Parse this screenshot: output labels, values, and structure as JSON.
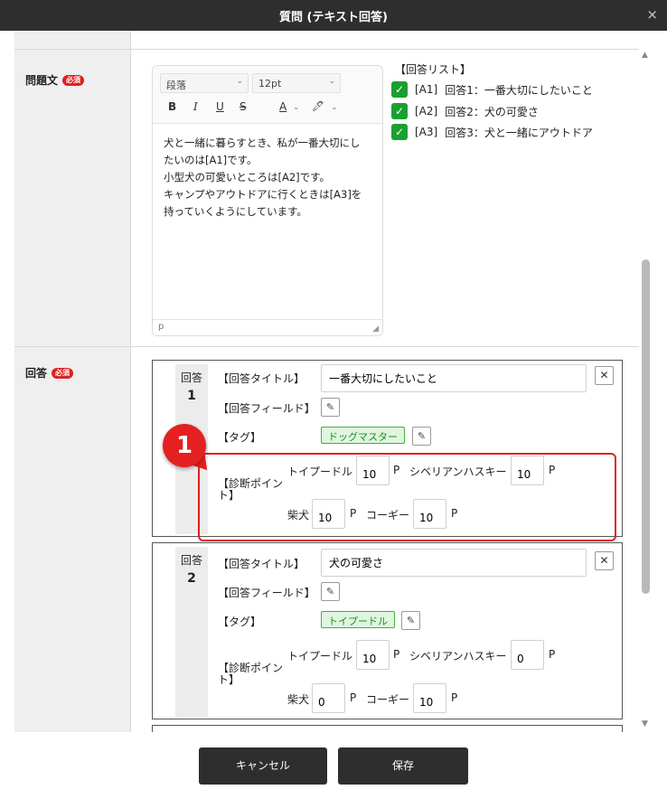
{
  "dialog": {
    "title": "質問 (テキスト回答)",
    "close_glyph": "×"
  },
  "fields": {
    "question_label": "問題文",
    "answers_label": "回答",
    "required_badge": "必須"
  },
  "editor": {
    "paragraph_select": "段落",
    "size_select": "12pt",
    "toolbar": {
      "bold": "B",
      "italic": "I",
      "underline": "U",
      "strike": "S",
      "font_color": "A",
      "highlight": "🖊"
    },
    "lines": [
      "犬と一緒に暮らすとき、私が一番大切にし",
      "たいのは[A1]です。",
      "小型犬の可愛いところは[A2]です。",
      "キャンプやアウトドアに行くときは[A3]を",
      "持っていくようにしています。"
    ],
    "status": "p"
  },
  "answer_list": {
    "title": "【回答リスト】",
    "items": [
      {
        "key": "[A1]",
        "text": "回答1：一番大切にしたいこと"
      },
      {
        "key": "[A2]",
        "text": "回答2：犬の可愛さ"
      },
      {
        "key": "[A3]",
        "text": "回答3：犬と一緒にアウトドア"
      }
    ]
  },
  "answers": [
    {
      "num_label": "回答",
      "num": "1",
      "title_label": "【回答タイトル】",
      "title_value": "一番大切にしたいこと",
      "field_label": "【回答フィールド】",
      "tag_label": "【タグ】",
      "tag": "ドッグマスター",
      "diag_label": "【診断ポイント】",
      "points": [
        {
          "name": "トイプードル",
          "value": "10",
          "unit": "P"
        },
        {
          "name": "シベリアンハスキー",
          "value": "10",
          "unit": "P"
        },
        {
          "name": "柴犬",
          "value": "10",
          "unit": "P"
        },
        {
          "name": "コーギー",
          "value": "10",
          "unit": "P"
        }
      ]
    },
    {
      "num_label": "回答",
      "num": "2",
      "title_label": "【回答タイトル】",
      "title_value": "犬の可愛さ",
      "field_label": "【回答フィールド】",
      "tag_label": "【タグ】",
      "tag": "トイプードル",
      "diag_label": "【診断ポイント】",
      "points": [
        {
          "name": "トイプードル",
          "value": "10",
          "unit": "P"
        },
        {
          "name": "シベリアンハスキー",
          "value": "0",
          "unit": "P"
        },
        {
          "name": "柴犬",
          "value": "0",
          "unit": "P"
        },
        {
          "name": "コーギー",
          "value": "10",
          "unit": "P"
        }
      ]
    }
  ],
  "annotation": {
    "number": "1",
    "color": "#e52020"
  },
  "footer": {
    "cancel": "キャンセル",
    "save": "保存"
  },
  "colors": {
    "header": "#2e2e2e",
    "check": "#1aa030",
    "tag_bg": "#dff5df",
    "tag_border": "#3bb33b",
    "required": "#e02020"
  }
}
